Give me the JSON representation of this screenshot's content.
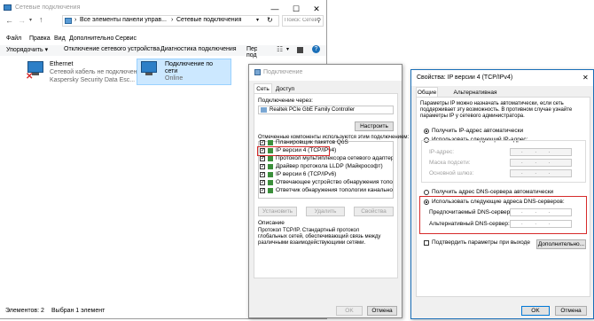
{
  "explorer": {
    "title": "Сетевые подключения",
    "address_parts": [
      "Все элементы панели управ...",
      "Сетевые подключения"
    ],
    "search_placeholder": "Поиск: Сетевые подклю...",
    "menu": [
      "Файл",
      "Правка",
      "Вид",
      "Дополнительно",
      "Сервис"
    ],
    "toolbar": [
      "Упорядочить ▾",
      "Отключение сетевого устройства",
      "Диагностика подключения",
      "Переименование подключения"
    ],
    "adapters": [
      {
        "name": "Ethernet",
        "line2": "Сетевой кабель не подключен",
        "line3": "Kaspersky Security Data Esc..."
      },
      {
        "name": "Подключение по",
        "line2": "сети",
        "line3": "Online"
      }
    ],
    "status_items": "Элементов: 2",
    "status_selected": "Выбран 1 элемент"
  },
  "props": {
    "title": "Подключение",
    "tabs": [
      "Сеть",
      "Доступ"
    ],
    "connect_using_label": "Подключение через:",
    "adapter": "Realtek PCIe GbE Family Controller",
    "configure_button": "Настроить",
    "components_label": "Отмеченные компоненты используются этим подключением:",
    "components": [
      "Планировщик пакетов QoS",
      "IP версии 4 (TCP/IPv4)",
      "Протокол мультиплексора сетевого адаптера (Ма",
      "Драйвер протокола LLDP (Майкрософт)",
      "IP версии 6 (TCP/IPv6)",
      "Отвечающее устройство обнаружения топологии к",
      "Ответчик обнаружения топологии канального уров"
    ],
    "install_button": "Установить",
    "uninstall_button": "Удалить",
    "properties_button": "Свойства",
    "description_label": "Описание",
    "description_text": "Протокол TCP/IP. Стандартный протокол глобальных сетей, обеспечивающий связь между различными взаимодействующими сетями.",
    "ok_button": "OK",
    "cancel_button": "Отмена"
  },
  "ipv4": {
    "title": "Свойства: IP версии 4 (TCP/IPv4)",
    "tabs": [
      "Общие",
      "Альтернативная конфигурация"
    ],
    "intro": "Параметры IP можно назначать автоматически, если сеть поддерживает эту возможность. В противном случае узнайте параметры IP у сетевого администратора.",
    "radio_auto_ip": "Получить IP-адрес автоматически",
    "radio_manual_ip": "Использовать следующий IP-адрес:",
    "ip_label": "IP-адрес:",
    "mask_label": "Маска подсети:",
    "gateway_label": "Основной шлюз:",
    "radio_auto_dns": "Получить адрес DNS-сервера автоматически",
    "radio_manual_dns": "Использовать следующие адреса DNS-серверов:",
    "pref_dns_label": "Предпочитаемый DNS-сервер:",
    "alt_dns_label": "Альтернативный DNS-сервер:",
    "ip_placeholder": ". . .",
    "validate_label": "Подтвердить параметры при выходе",
    "advanced_button": "Дополнительно...",
    "ok_button": "OK",
    "cancel_button": "Отмена"
  },
  "colors": {
    "accent": "#0078d7",
    "highlight": "#d62b2b"
  }
}
